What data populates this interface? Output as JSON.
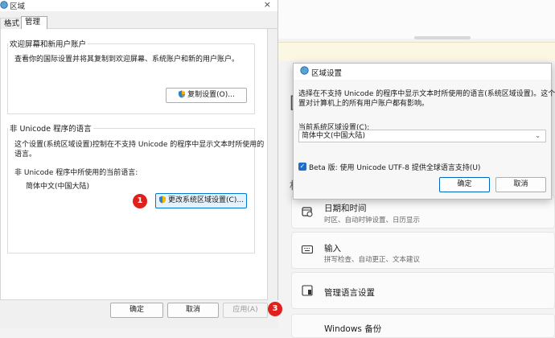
{
  "region_dialog": {
    "title": "区域",
    "close": "×",
    "tabs": [
      "格式",
      "管理"
    ],
    "welcome": {
      "legend": "欢迎屏幕和新用户账户",
      "text": "查看你的国际设置并将其复制到欢迎屏幕、系统账户和新的用户账户。",
      "copy_button": "复制设置(O)..."
    },
    "non_unicode": {
      "legend": "非 Unicode 程序的语言",
      "text_line1": "这个设置(系统区域设置)控制在不支持 Unicode 的程序中显示文本时所使用的",
      "text_line2": "语言。",
      "current_label": "非 Unicode 程序中所使用的当前语言:",
      "current_value": "简体中文(中国大陆)",
      "change_button": "更改系统区域设置(C)..."
    },
    "footer": {
      "ok": "确定",
      "cancel": "取消",
      "apply": "应用(A)"
    }
  },
  "locale_dialog": {
    "title": "区域设置",
    "description_line1": "选择在不支持 Unicode 的程序中显示文本时所使用的语言(系统区域设置)。这个设",
    "description_line2": "置对计算机上的所有用户账户都有影响。",
    "current_label": "当前系统区域设置(C):",
    "current_value": "简体中文(中国大陆)",
    "beta_checkbox_label": "Beta 版: 使用 Unicode UTF-8 提供全球语言支持(U)",
    "beta_checked": true,
    "ok": "确定",
    "cancel": "取消"
  },
  "settings_bg": {
    "cards": [
      {
        "title": "日期和时间",
        "subtitle": "时区、自动时钟设置、日历显示",
        "icon": "calendar-clock-icon"
      },
      {
        "title": "输入",
        "subtitle": "拼写检查、自动更正、文本建议",
        "icon": "keyboard-icon"
      },
      {
        "title": "管理语言设置",
        "subtitle": "",
        "icon": "language-settings-icon"
      },
      {
        "title": "Windows 备份",
        "subtitle": "",
        "icon": "backup-icon"
      }
    ],
    "partial_chars": [
      "[",
      "相"
    ]
  },
  "step_badges": [
    "1",
    "2",
    "3"
  ],
  "colors": {
    "badge_red": "#e0211b",
    "accent_blue": "#0067c0",
    "dialog_bg": "#f0f0f0"
  }
}
